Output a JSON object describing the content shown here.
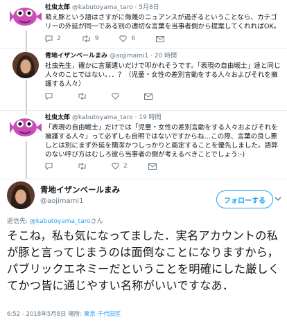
{
  "tweets": [
    {
      "name": "社虫太郎",
      "handle": "@kabutoyama_taro",
      "dot": "·",
      "time": "5月8日",
      "text": "萌え豚という語はさすがに侮蔑のニュアンスが過ぎるということなら、カテゴリーの外延が同一である別の適切な言葉を当事者側から提案してくれればOK。",
      "replies": "2",
      "retweets": "9",
      "likes": "6"
    },
    {
      "name": "青地イザンベールまみ",
      "handle": "@aojimami1",
      "dot": "·",
      "time": "20 時間",
      "text": "社虫先生，確かに言葉遣いだけで叩かれそうです。「表現の自由戦士」達と同じ人々のことではない。．．？（児童・女性の差別言動をする人々およびそれを擁護する人々）",
      "replies": "",
      "retweets": "",
      "likes": ""
    },
    {
      "name": "社虫太郎",
      "handle": "@kabutoyama_taro",
      "dot": "·",
      "time": "19 時間",
      "text": "「表現の自由戦士」だけでは「児童・女性の差別言動をする人々およびそれを擁護する人々」って必ずしも自明ではないですからね…この際、言葉の良し悪しとは別にまず外延を簡潔かつしっかりと画定することを優先しました。語弊のない呼び方はむしろ彼ら当事者の側が考えるべきことでしょう:-)",
      "replies": "",
      "retweets": "",
      "likes": "2"
    }
  ],
  "main": {
    "name": "青地イザンベールまみ",
    "handle": "@aojimami1",
    "follow_label": "フォローする",
    "reply_prefix": "返信先: ",
    "reply_mention": "@kabutoyama_taro",
    "reply_suffix": "さん",
    "text": "そこね，私も気になってました．実名アカウントの私が豚と言ってじまうのは面倒なことになりますから，パブリックエネミーだということを明確にした厳しくてかつ皆に通じやすい名称がいいですなあ．",
    "meta_time": "6:52 - 2018年5月8日 場所: ",
    "meta_location": "東京 千代田区"
  },
  "colors": {
    "accent": "#1da1f2",
    "mascot": "#c94fb6",
    "muted": "#657786"
  }
}
